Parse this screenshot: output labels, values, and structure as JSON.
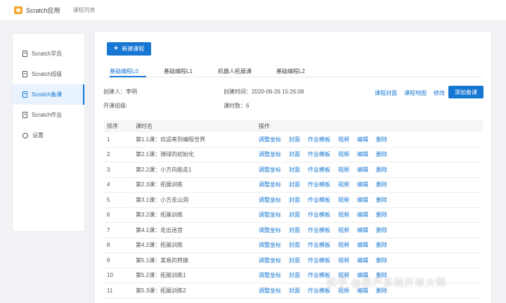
{
  "header": {
    "app_title": "Scratch应用",
    "breadcrumb": "课程列表"
  },
  "sidebar": {
    "items": [
      {
        "label": "Scratch学员",
        "icon": "document-icon",
        "active": false
      },
      {
        "label": "Scratch班级",
        "icon": "document-icon",
        "active": false
      },
      {
        "label": "Scratch备课",
        "icon": "document-icon",
        "active": true
      },
      {
        "label": "Scratch作业",
        "icon": "document-icon",
        "active": false
      },
      {
        "label": "设置",
        "icon": "gear-icon",
        "active": false
      }
    ]
  },
  "main": {
    "new_course_label": "新建课程",
    "tabs": [
      {
        "label": "基础编程L0",
        "active": true
      },
      {
        "label": "基础编程L1",
        "active": false
      },
      {
        "label": "机器人拓展课",
        "active": false
      },
      {
        "label": "基础编程L2",
        "active": false
      }
    ],
    "info": {
      "creator": "创建人：李明",
      "created_time": "创建时间：2020-06-26 15:26:08",
      "start_class": "开课班级:",
      "lesson_count": "课时数：6"
    },
    "actions": {
      "course_cover": "课程封面",
      "course_map": "课程地图",
      "edit": "修改",
      "add_lesson": "添加备课"
    },
    "table": {
      "headers": [
        "排序",
        "课时名",
        "操作"
      ],
      "op_labels": [
        "调整坐标",
        "封面",
        "作业模板",
        "视频",
        "编辑",
        "删除"
      ],
      "rows": [
        {
          "num": "1",
          "name": "第1.1课：欢迎来到编程世界"
        },
        {
          "num": "2",
          "name": "第2.1课：弹球的初始化"
        },
        {
          "num": "3",
          "name": "第2.2课：小方向船走1"
        },
        {
          "num": "4",
          "name": "第2.3课：拓展训练"
        },
        {
          "num": "5",
          "name": "第3.1课：小方走山洞"
        },
        {
          "num": "6",
          "name": "第3.2课：拓展训练"
        },
        {
          "num": "7",
          "name": "第4.1课：走出迷宫"
        },
        {
          "num": "8",
          "name": "第4.2课：拓展训练"
        },
        {
          "num": "9",
          "name": "第5.1课：某易的转换"
        },
        {
          "num": "10",
          "name": "第5.2课：拓展训练1"
        },
        {
          "num": "11",
          "name": "第5.3课：拓展训练2"
        }
      ]
    }
  },
  "watermark": "知乎 @房产系统开单大师",
  "colors": {
    "accent": "#1677d2",
    "background": "#f0f2f5",
    "logo": "#f2a531"
  }
}
